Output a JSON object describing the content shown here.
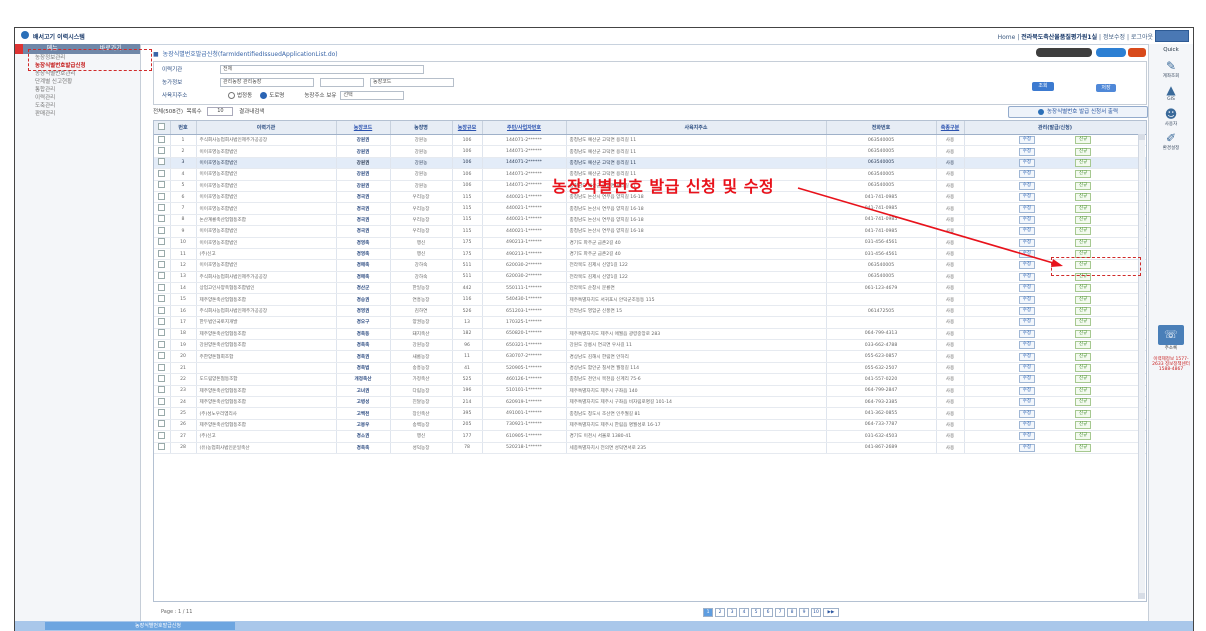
{
  "window": {
    "title": "배서고기 이력시스템",
    "toplinks": [
      "Home",
      "전라북도축산물품질평가원1실",
      "정보수정",
      "로그아웃"
    ]
  },
  "leftnav": {
    "header": [
      "메뉴",
      "바로가기"
    ],
    "items": [
      {
        "label": "농장정보관리",
        "active": false
      },
      {
        "label": "농장식별번호발급신청",
        "active": true
      },
      {
        "label": "농장식별번호관리",
        "active": false
      },
      {
        "label": "단계별 신고현황",
        "active": false
      },
      {
        "label": "통합관리",
        "active": false
      },
      {
        "label": "이력관리",
        "active": false
      },
      {
        "label": "도축관리",
        "active": false
      },
      {
        "label": "판매관리",
        "active": false
      }
    ]
  },
  "page": {
    "title": "농장식별번호발급신청(farmIdentifiedIssuedApplicationList.do)",
    "search_label": "조회",
    "save_label": "저장"
  },
  "filter": {
    "org_label": "이력기관",
    "org_value": "전체",
    "farm_label": "농가정보",
    "farm_value1": "관리농장 관리농장",
    "farm_value2": "농장코드",
    "addr_label": "사육지주소",
    "radio1": "법정동",
    "radio2": "도로명",
    "addr_check_label": "농장주소 보유",
    "addr_select": "선택"
  },
  "list_info": {
    "total": "전체(508건)",
    "per_page_label": "목록수",
    "per_page": "10",
    "result_label": "결과내검색",
    "apply_button": "농장식별번호 발급 신청서 출력"
  },
  "annotation": {
    "text": "농장식별번호 발급 신청 및 수정"
  },
  "table": {
    "headers": [
      "",
      "번호",
      "이력기관",
      "농장코드",
      "농장명",
      "농장규모",
      "주민/사업자번호",
      "사육지주소",
      "전화번호",
      "축종구분",
      "관리(발급/신청)"
    ],
    "rows": [
      [
        "1",
        "주식회사농업회사법인제주가공공장",
        "강원권",
        "강원농",
        "106",
        "144071-2******",
        "충청남도 예산군 고덕면 용리길 11",
        "063540005",
        "사용"
      ],
      [
        "2",
        "이이호영농조합법인",
        "강원권",
        "강원농",
        "106",
        "144071-2******",
        "충청남도 예산군 고덕면 용리길 11",
        "063540005",
        "사용"
      ],
      [
        "3",
        "이이호영농조합법인",
        "강원권",
        "강원농",
        "106",
        "144071-2******",
        "충청남도 예산군 고덕면 용리길 11",
        "063540005",
        "사용"
      ],
      [
        "4",
        "이이호영농조합법인",
        "강원권",
        "강원농",
        "106",
        "144071-2******",
        "충청남도 예산군 고덕면 용리길 11",
        "063540005",
        "사용"
      ],
      [
        "5",
        "이이호영농조합법인",
        "강원권",
        "강원농",
        "106",
        "144071-2******",
        "충청남도 예산군 고덕면 용리길 11",
        "063540005",
        "사용"
      ],
      [
        "6",
        "이이호영농조합법인",
        "경국권",
        "우리농장",
        "115",
        "440021-1******",
        "충청남도 논산시 연무읍 양지길 16-18",
        "041-741-0985",
        "사용"
      ],
      [
        "7",
        "이이호영농조합법인",
        "경국권",
        "우리농장",
        "115",
        "440021-1******",
        "충청남도 논산시 연무읍 양지길 16-18",
        "041-741-0985",
        "사용"
      ],
      [
        "8",
        "논산계룡축산업협동조합",
        "경국권",
        "우리농장",
        "115",
        "440021-1******",
        "충청남도 논산시 연무읍 양지길 16-18",
        "041-741-0985",
        "사용"
      ],
      [
        "9",
        "이이호영농조합법인",
        "경국권",
        "우리농장",
        "115",
        "440021-1******",
        "충청남도 논산시 연무읍 양지길 16-18",
        "041-741-0985",
        "사용"
      ],
      [
        "10",
        "이이호영농조합법인",
        "경영축",
        "행신",
        "175",
        "490213-1******",
        "경기도 파주군 금촌2길 40",
        "031-456-4561",
        "사용"
      ],
      [
        "11",
        "(주)신고",
        "경영축",
        "행신",
        "175",
        "490213-1******",
        "경기도 파주군 금촌2길 40",
        "031-456-4561",
        "사용"
      ],
      [
        "12",
        "이이호영농조합법인",
        "경매축",
        "강하숙",
        "511",
        "620030-2******",
        "전라북도 김제시 신양1길 122",
        "063540005",
        "사용"
      ],
      [
        "13",
        "주식회사농업회사법인제주가공공장",
        "경매축",
        "강하숙",
        "511",
        "620030-2******",
        "전라북도 김제시 신양1길 122",
        "063540005",
        "사용"
      ],
      [
        "14",
        "상업고인사양축협동조합법인",
        "경산군",
        "한일농장",
        "442",
        "550111-1******",
        "전라북도 순창시 문룡면",
        "061-123-4679",
        "사용"
      ],
      [
        "15",
        "제주양돈축산업협동조합",
        "경승권",
        "연흥농장",
        "116",
        "540430-1******",
        "제주특별자치도 서귀포시 안덕군조동동 115",
        "",
        "사용"
      ],
      [
        "16",
        "주식회사농업회사법인제주가공공장",
        "경영권",
        "김하연",
        "526",
        "651203-1******",
        "전라남도 영암군 신풍면 15",
        "061472505",
        "사용"
      ],
      [
        "17",
        "한두법인국토지개발",
        "경오구",
        "양권농장",
        "13",
        "170325-1******",
        "",
        "",
        "사용"
      ],
      [
        "18",
        "제주양돈축산업협동조합",
        "경축동",
        "돼지축산",
        "182",
        "650820-1******",
        "제주특별자치도 제주시 애월읍 광령중앙로 283",
        "064-799-4313",
        "사용"
      ],
      [
        "19",
        "강원양돈축산업협동조합",
        "경축축",
        "강원농장",
        "96",
        "650321-1******",
        "강원도 강릉시 연곡면 우사길 11",
        "033-662-4788",
        "사용"
      ],
      [
        "20",
        "주한양돈협회조합",
        "경축권",
        "새롬농장",
        "11",
        "630707-2******",
        "경상남도 김해시 한림면 안하리",
        "055-623-0857",
        "사용"
      ],
      [
        "21",
        "",
        "경축법",
        "송흥농장",
        "41",
        "520905-1******",
        "경상남도 함안군 칠서면 월정길 114",
        "055-632-2507",
        "사용"
      ],
      [
        "22",
        "도드림양돈협동조합",
        "개정축산",
        "가정축산",
        "525",
        "460126-1******",
        "충청남도 천안시 목천읍 신계리 75-6",
        "041-557-0220",
        "사용"
      ],
      [
        "23",
        "제주양돈축산업협동조합",
        "고녀권",
        "다림농장",
        "196",
        "510101-1******",
        "제주특별자치도 제주시 구좌읍 140",
        "064-799-2847",
        "사용"
      ],
      [
        "24",
        "제주양돈축산업협동조합",
        "고병성",
        "진달농장",
        "214",
        "620919-1******",
        "제주특별자치도 제주시 구좌읍 비자림로명길 101-14",
        "064-793-2385",
        "사용"
      ],
      [
        "25",
        "(주)성노우리엠리사",
        "고백천",
        "장인축산",
        "395",
        "491001-1******",
        "충청남도 청도시 조산면 인주월길 81",
        "041-362-0855",
        "사용"
      ],
      [
        "26",
        "제주양돈축산업협동조합",
        "고봉우",
        "송백농장",
        "205",
        "730921-1******",
        "제주특별자치도 제주시 한림읍 명월성로 16-17",
        "064-733-7787",
        "사용"
      ],
      [
        "27",
        "(주)신고",
        "경소권",
        "행신",
        "177",
        "610905-1******",
        "경기도 이천시 서울로 1380-41",
        "031-632-4503",
        "사용"
      ],
      [
        "28",
        "(유)농업회사법인운일축산",
        "경축축",
        "성덕농장",
        "78",
        "520218-1******",
        "세종특별자치시 전의면 성덕면서로 235",
        "041-867-2689",
        "사용"
      ]
    ],
    "btn_edit": "수정",
    "btn_issue": "신규"
  },
  "pager": {
    "info": "Page : 1 / 11",
    "pages": [
      "1",
      "2",
      "3",
      "4",
      "5",
      "6",
      "7",
      "8",
      "9",
      "10",
      "▶▶"
    ]
  },
  "quick": {
    "title": "Quick",
    "items": [
      "계좌조회",
      "GIS",
      "사용자",
      "환경설정",
      "주소록"
    ],
    "note": "이력제정보 1577-2633 정보정책센터 1588-4867"
  },
  "taskbar": {
    "item": "농장식별번호발급신청"
  }
}
